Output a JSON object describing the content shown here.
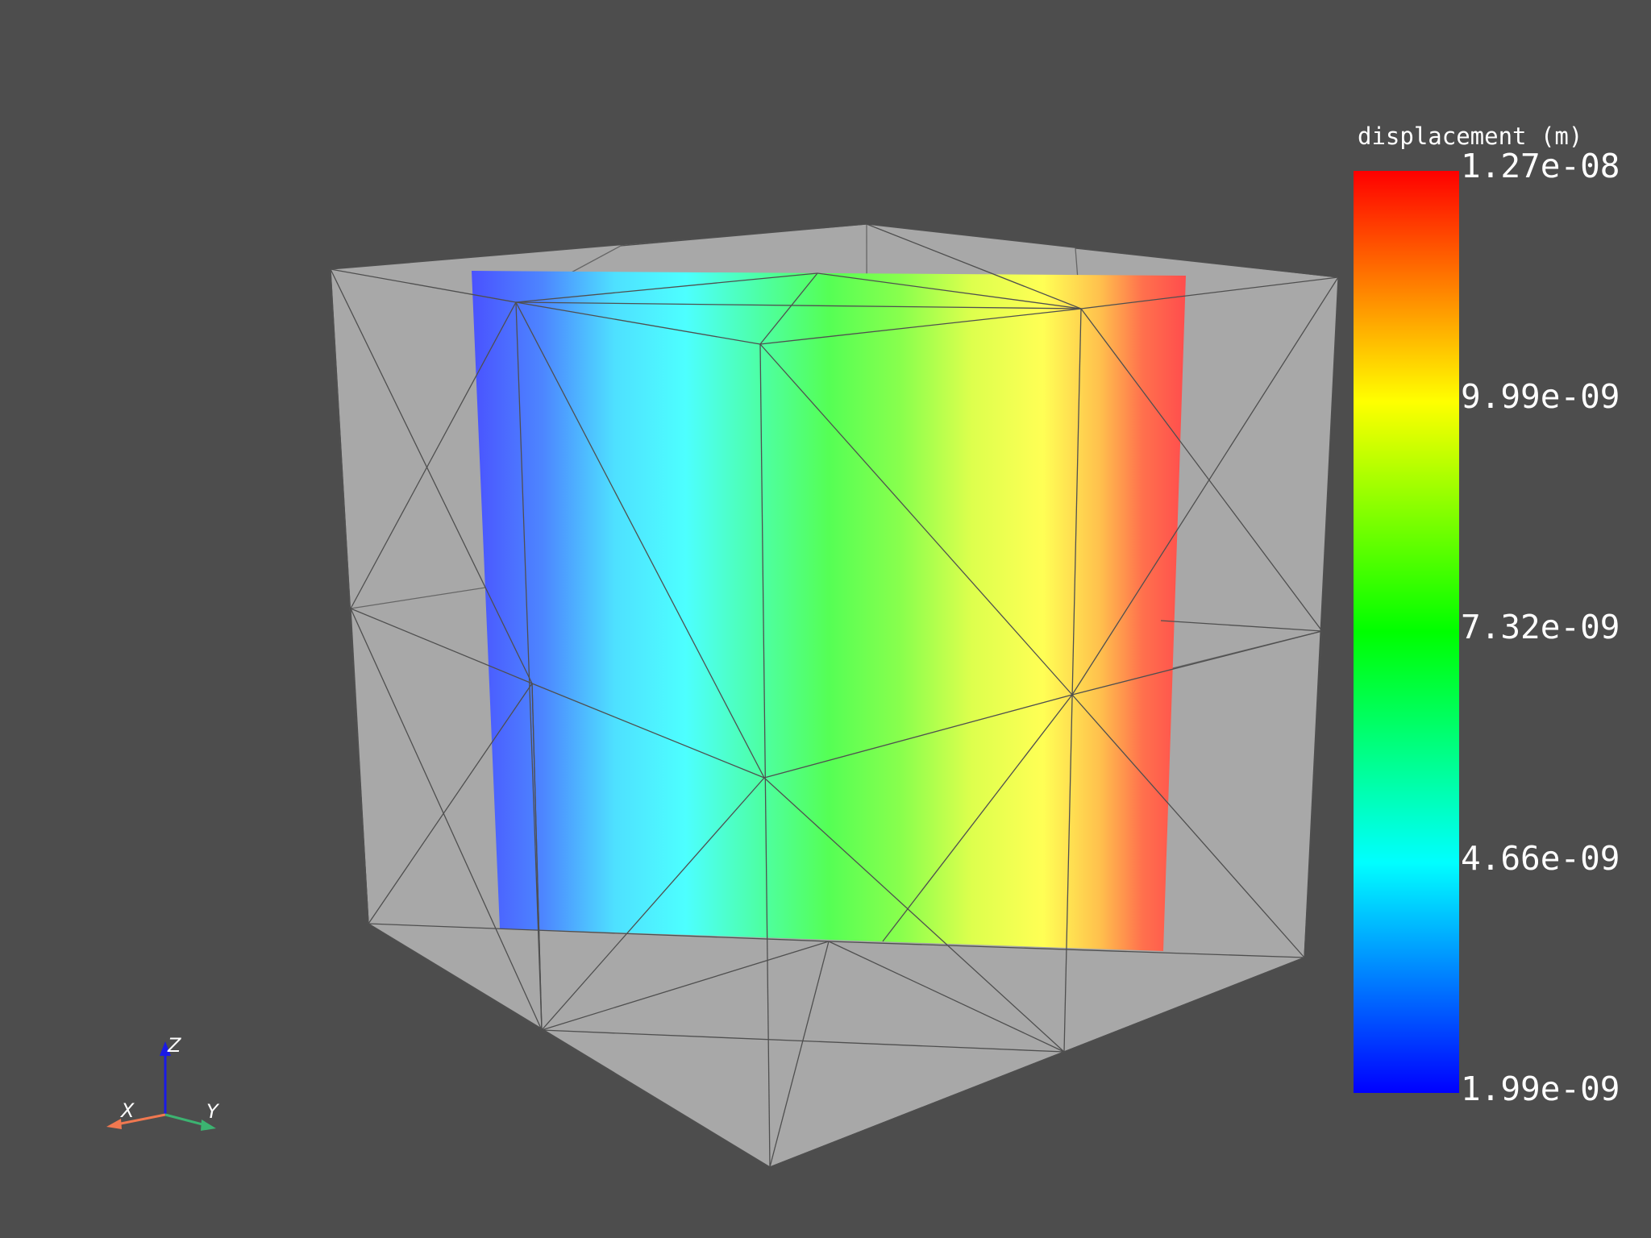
{
  "scene": {
    "background_color": "#4d4d4d",
    "mesh_color": "#a8a8a8",
    "edge_color": "#555555",
    "slice_colormap": "jet",
    "slice_gradient_direction": "left-to-right (low to high)"
  },
  "scalar_bar": {
    "title": "displacement (m)",
    "ticks": [
      {
        "label": "1.27e-08",
        "value": 1.27e-08
      },
      {
        "label": "9.99e-09",
        "value": 9.99e-09
      },
      {
        "label": "7.32e-09",
        "value": 7.32e-09
      },
      {
        "label": "4.66e-09",
        "value": 4.66e-09
      },
      {
        "label": "1.99e-09",
        "value": 1.99e-09
      }
    ],
    "range": [
      1.99e-09,
      1.27e-08
    ],
    "colors": [
      "#0000ff",
      "#00ffff",
      "#00ff00",
      "#ffff00",
      "#ff0000"
    ]
  },
  "orientation_axes": {
    "x_label": "X",
    "y_label": "Y",
    "z_label": "Z",
    "x_color": "#f07850",
    "y_color": "#3cb371",
    "z_color": "#1a1ae6"
  }
}
